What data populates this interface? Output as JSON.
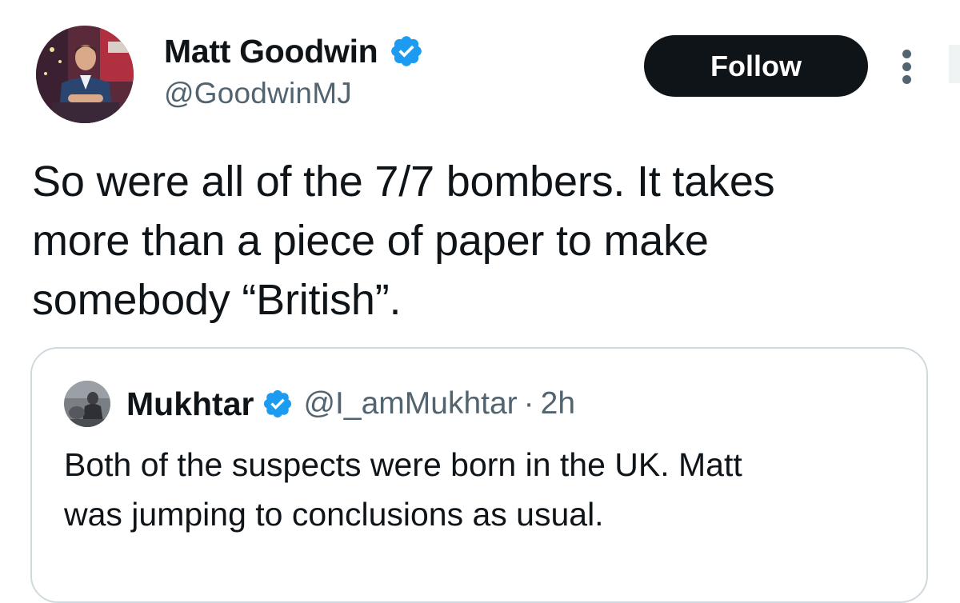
{
  "tweet": {
    "author": {
      "display_name": "Matt Goodwin",
      "handle": "@GoodwinMJ",
      "verified": true,
      "avatar_icon": "profile-photo"
    },
    "follow_label": "Follow",
    "more_icon": "more-vertical-icon",
    "text": "So were all of the 7/7 bombers. It takes\nmore than a piece of paper to make\nsomebody “British”."
  },
  "quoted_tweet": {
    "author": {
      "display_name": "Mukhtar",
      "handle": "@I_amMukhtar",
      "verified": true,
      "avatar_icon": "profile-photo"
    },
    "separator": "·",
    "time": "2h",
    "text": "Both of the suspects were born in the UK. Matt\nwas jumping to conclusions as usual."
  },
  "colors": {
    "text_primary": "#0f1419",
    "text_secondary": "#536471",
    "verified_blue": "#1d9bf0",
    "follow_bg": "#0f1419",
    "border": "#cfd9de"
  }
}
